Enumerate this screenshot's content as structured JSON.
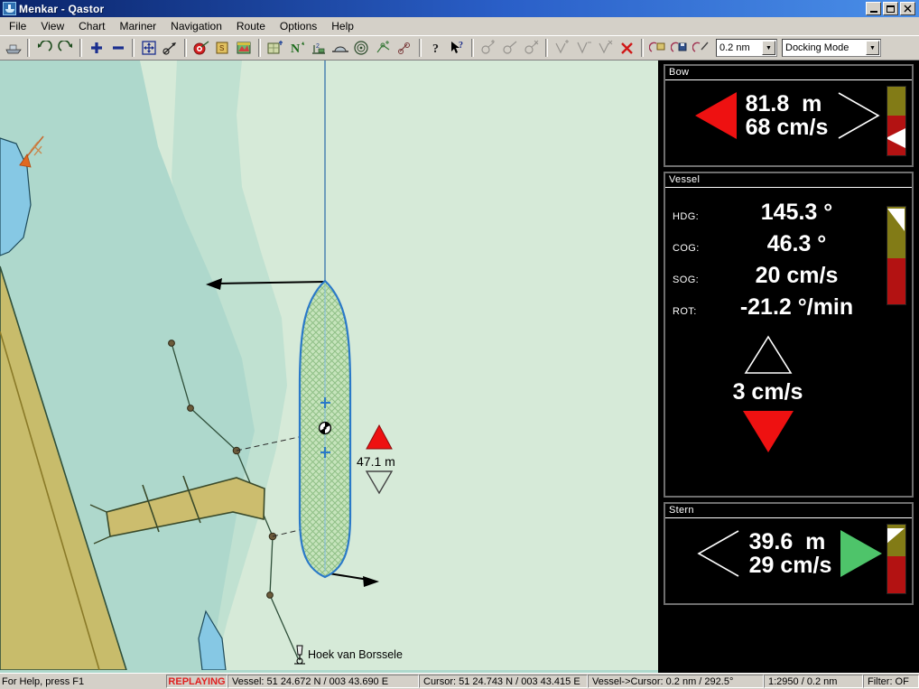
{
  "window": {
    "title": "Menkar - Qastor",
    "icon": "ship-app-icon",
    "buttons": [
      {
        "name": "minimize",
        "glyph": "_"
      },
      {
        "name": "restore",
        "glyph": "❐"
      },
      {
        "name": "close",
        "glyph": "✕"
      }
    ]
  },
  "menu": {
    "items": [
      "File",
      "View",
      "Chart",
      "Mariner",
      "Navigation",
      "Route",
      "Options",
      "Help"
    ]
  },
  "toolbar": {
    "icons": [
      "vessel-icon",
      "undo-icon",
      "redo-icon",
      "zoom-in-icon",
      "zoom-out-icon",
      "pan-icon",
      "measure-icon",
      "target-icon",
      "chart-load-icon",
      "chart-image-icon",
      "chart-quilt-icon",
      "north-up-icon",
      "depth-icon",
      "berth-icon",
      "radar-icon",
      "route-plot-icon",
      "route-cut-icon",
      "info-icon",
      "help-pointer-icon",
      "add-waypoint-icon",
      "edit-waypoint-icon",
      "delete-waypoint-icon",
      "add-leg-icon",
      "split-leg-icon",
      "remove-leg-icon",
      "delete-route-icon",
      "open-route-icon",
      "save-route-icon",
      "edit-route-icon"
    ],
    "range_combo": {
      "value": "0.2 nm",
      "name": "range-select"
    },
    "mode_combo": {
      "value": "Docking Mode",
      "name": "mode-select"
    }
  },
  "chart": {
    "vessel_label": "47.1 m",
    "place_label": "Hoek van Borssele",
    "features": {
      "land_color": "#c8bc6b",
      "water_color": "#aed8cc",
      "shallow_color": "#d6ead8",
      "deep_water_color": "#86c8e4",
      "vessel_outline": "#2a79c8",
      "vessel_fill": "#b9ddb0",
      "current_arrow_color": "#e06820"
    }
  },
  "panels": {
    "bow": {
      "title": "Bow",
      "distance": "81.8  m",
      "speed": "68 cm/s",
      "left_indicator": "red-left-triangle",
      "right_indicator": "white-right-triangle-outline",
      "gauge": {
        "top_color": "#827b16",
        "bottom_color": "#b31212",
        "marker": "white-left-wedge"
      }
    },
    "vessel": {
      "title": "Vessel",
      "rows": [
        {
          "label": "HDG:",
          "value": "145.3 °"
        },
        {
          "label": "COG:",
          "value": "46.3 °"
        },
        {
          "label": "SOG:",
          "value": "20 cm/s"
        },
        {
          "label": "ROT:",
          "value": "-21.2 °/min"
        }
      ],
      "drift": {
        "up_indicator": "white-up-triangle-outline",
        "value": "3 cm/s",
        "down_indicator": "red-down-triangle"
      },
      "gauge": {
        "top_color": "#827b16",
        "bottom_color": "#b31212",
        "marker": "white-up-wedge"
      }
    },
    "stern": {
      "title": "Stern",
      "distance": "39.6  m",
      "speed": "29 cm/s",
      "left_indicator": "white-left-triangle-outline",
      "right_indicator": "green-right-triangle",
      "gauge": {
        "top_color": "#827b16",
        "bottom_color": "#b31212",
        "marker": "white-right-wedge"
      }
    }
  },
  "statusbar": {
    "help": "For Help, press F1",
    "replaying": "REPLAYING",
    "vessel_pos": "Vessel: 51 24.672 N / 003 43.690 E",
    "cursor_pos": "Cursor: 51 24.743 N / 003 43.415 E",
    "vessel_to_cursor": "Vessel->Cursor: 0.2 nm / 292.5°",
    "scale": "1:2950 / 0.2 nm",
    "filter": "Filter: OF"
  }
}
